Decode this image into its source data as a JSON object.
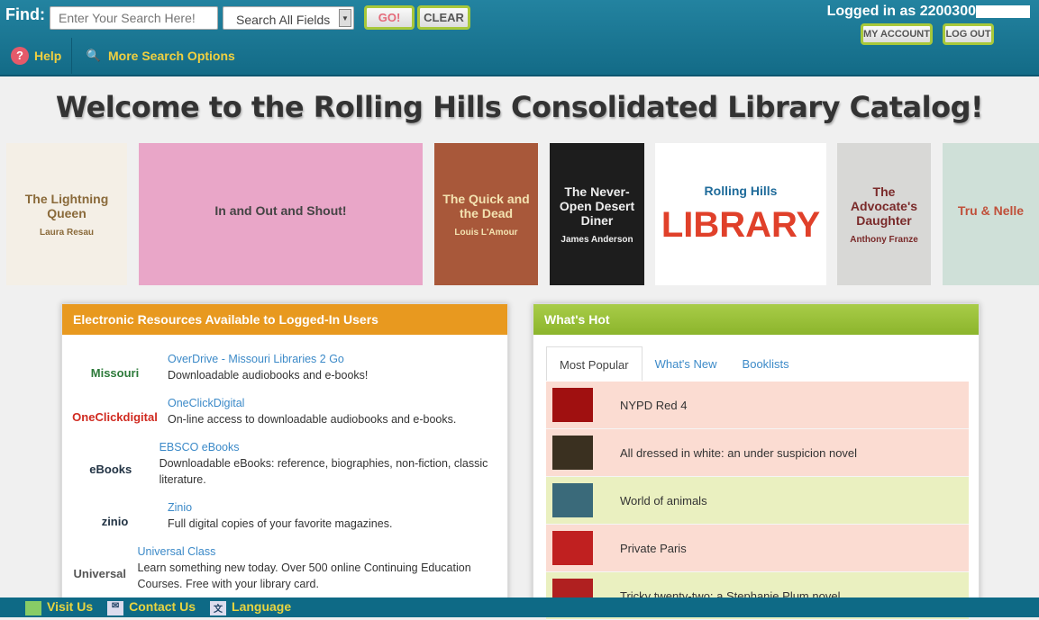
{
  "header": {
    "find_label": "Find:",
    "search_placeholder": "Enter Your Search Here!",
    "search_field": "Search All Fields",
    "go": "GO!",
    "clear": "CLEAR",
    "help": "Help",
    "more_options": "More Search Options",
    "logged_in": "Logged in as 2200300",
    "my_account": "MY ACCOUNT",
    "log_out": "LOG OUT"
  },
  "title": "Welcome to the Rolling Hills Consolidated Library Catalog!",
  "carousel": [
    {
      "title": "The Lightning Queen",
      "author": "Laura Resau",
      "bg": "#f4efe6",
      "fg": "#8a6a3a"
    },
    {
      "title": "In and Out and Shout!",
      "author": "",
      "bg": "#e9a6c8",
      "fg": "#444"
    },
    {
      "title": "The Quick and the Dead",
      "author": "Louis L'Amour",
      "bg": "#a8583a",
      "fg": "#f3e2b0"
    },
    {
      "title": "The Never-Open Desert Diner",
      "author": "James Anderson",
      "bg": "#1d1d1d",
      "fg": "#eee"
    },
    {
      "title": "Rolling Hills",
      "author": "LIBRARY",
      "bg": "#ffffff",
      "fg": "#1f6b9a"
    },
    {
      "title": "The Advocate's Daughter",
      "author": "Anthony Franze",
      "bg": "#d8d8d6",
      "fg": "#7a2a2a"
    },
    {
      "title": "Tru & Nelle",
      "author": "",
      "bg": "#cfe0d8",
      "fg": "#c0503a"
    }
  ],
  "electronic": {
    "heading": "Electronic Resources Available to Logged-In Users",
    "color": "#e8991f",
    "items": [
      {
        "logo": "Missouri",
        "name": "OverDrive - Missouri Libraries 2 Go",
        "desc": "Downloadable audiobooks and e-books!"
      },
      {
        "logo": "OneClickdigital",
        "name": "OneClickDigital",
        "desc": "On-line access to downloadable audiobooks and e-books."
      },
      {
        "logo": "eBooks",
        "name": "EBSCO eBooks",
        "desc": "Downloadable eBooks: reference, biographies, non-fiction, classic literature."
      },
      {
        "logo": "zinio",
        "name": "Zinio",
        "desc": "Full digital copies of your favorite magazines."
      },
      {
        "logo": "Universal",
        "name": "Universal Class",
        "desc": "Learn something new today. Over 500 online Continuing Education Courses. Free with your library card."
      }
    ]
  },
  "hot": {
    "heading": "What's Hot",
    "color": "#9cc33a",
    "tabs": [
      "Most Popular",
      "What's New",
      "Booklists"
    ],
    "items": [
      {
        "title": "NYPD Red 4",
        "bg": "#fbdcd2",
        "thumb": "#a01010"
      },
      {
        "title": "All dressed in white: an under suspicion novel",
        "bg": "#fbdcd2",
        "thumb": "#3a3020"
      },
      {
        "title": "World of animals",
        "bg": "#eaf0c0",
        "thumb": "#3a6a7a"
      },
      {
        "title": "Private Paris",
        "bg": "#fbdcd2",
        "thumb": "#c02020"
      },
      {
        "title": "Tricky twenty-two: a Stephanie Plum novel",
        "bg": "#eaf0c0",
        "thumb": "#b02020"
      }
    ]
  },
  "footer": {
    "visit": "Visit Us",
    "contact": "Contact Us",
    "language": "Language"
  }
}
